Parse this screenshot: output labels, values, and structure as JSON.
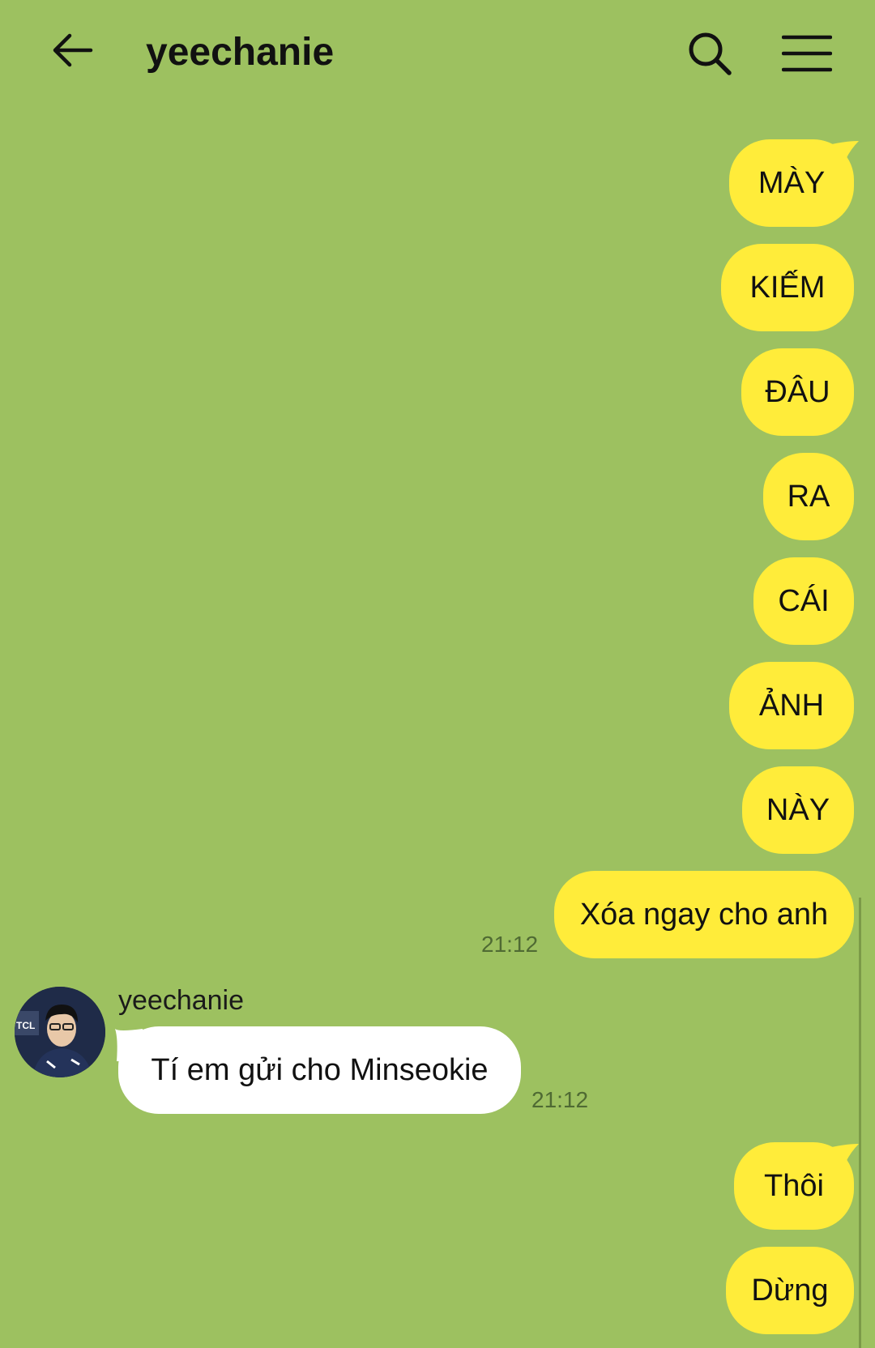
{
  "header": {
    "title": "yeechanie",
    "back_icon": "arrow-left-icon",
    "search_icon": "search-icon",
    "menu_icon": "hamburger-menu-icon"
  },
  "colors": {
    "background": "#9dc160",
    "outgoing_bubble": "#ffec3a",
    "incoming_bubble": "#ffffff"
  },
  "messages": {
    "m1": {
      "text": "MÀY"
    },
    "m2": {
      "text": "KIẾM"
    },
    "m3": {
      "text": "ĐÂU"
    },
    "m4": {
      "text": "RA"
    },
    "m5": {
      "text": "CÁI"
    },
    "m6": {
      "text": "ẢNH"
    },
    "m7": {
      "text": "NÀY"
    },
    "m8": {
      "text": "Xóa ngay cho anh",
      "time": "21:12"
    },
    "m9": {
      "sender": "yeechanie",
      "text": "Tí em gửi cho Minseokie",
      "time": "21:12"
    },
    "m10": {
      "text": "Thôi"
    },
    "m11": {
      "text": "Dừng"
    }
  }
}
